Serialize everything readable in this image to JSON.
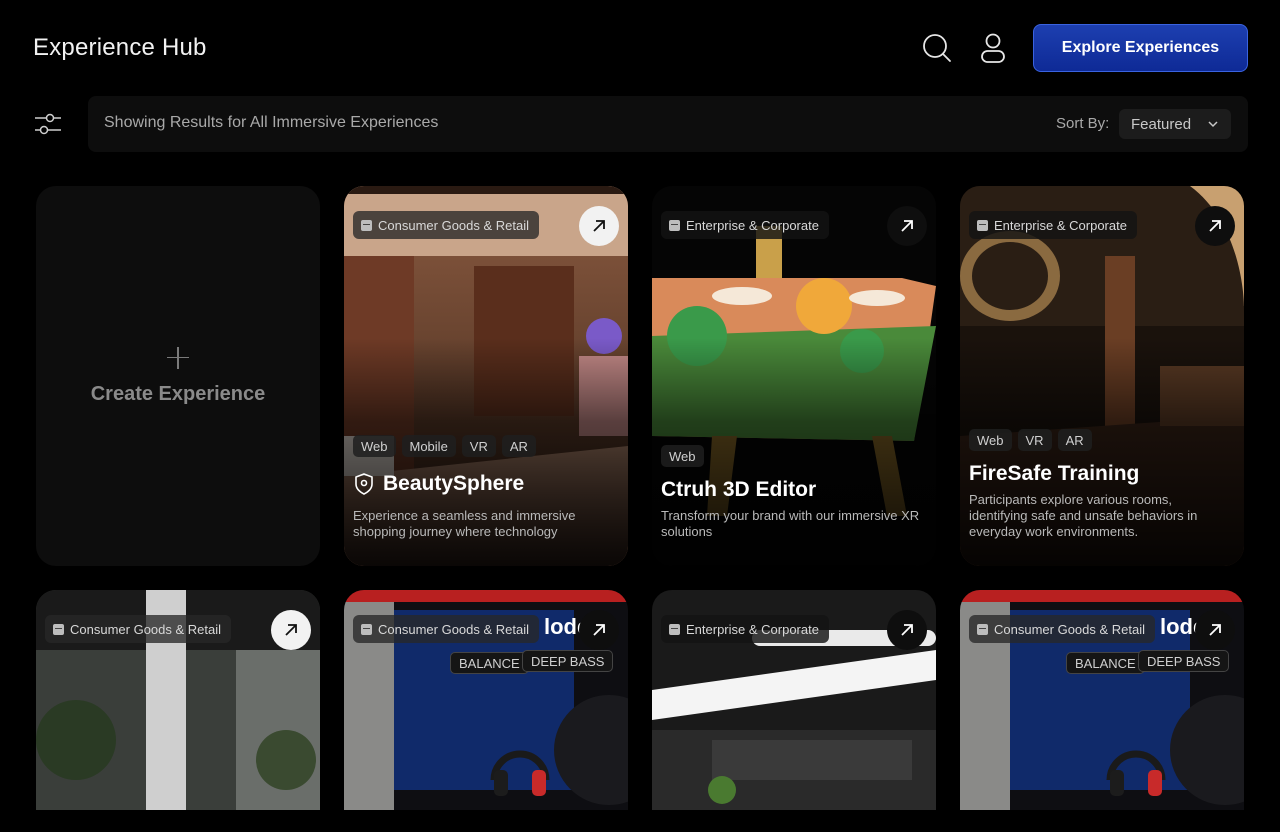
{
  "header": {
    "brand": "Experience Hub",
    "cta_label": "Explore Experiences",
    "search_icon": "search-icon",
    "user_icon": "user-icon"
  },
  "filter": {
    "summary": "Showing Results for All Immersive Experiences",
    "sort_label": "Sort By:",
    "sort_value": "Featured"
  },
  "create_card": {
    "label": "Create Experience"
  },
  "cards": [
    {
      "category": "Consumer Goods & Retail",
      "tags": [
        "Web",
        "Mobile",
        "VR",
        "AR"
      ],
      "title": "BeautySphere",
      "description": "Experience a seamless and immersive shopping journey where technology"
    },
    {
      "category": "Enterprise & Corporate",
      "tags": [
        "Web"
      ],
      "title": "Ctruh 3D Editor",
      "description": "Transform your brand with our immersive XR solutions"
    },
    {
      "category": "Enterprise & Corporate",
      "tags": [
        "Web",
        "VR",
        "AR"
      ],
      "title": "FireSafe Training",
      "description": "Participants explore various rooms, identifying safe and unsafe behaviors in everyday work environments."
    },
    {
      "category": "Consumer Goods & Retail"
    },
    {
      "category": "Consumer Goods & Retail",
      "scene_text": [
        "lode",
        "BALANCE",
        "DEEP BASS"
      ]
    },
    {
      "category": "Enterprise & Corporate"
    },
    {
      "category": "Consumer Goods & Retail",
      "scene_text": [
        "lode",
        "BALANCE",
        "DEEP BASS"
      ]
    }
  ],
  "colors": {
    "accent": "#1d3fb0",
    "background": "#000000",
    "panel": "#0d0d0d"
  }
}
